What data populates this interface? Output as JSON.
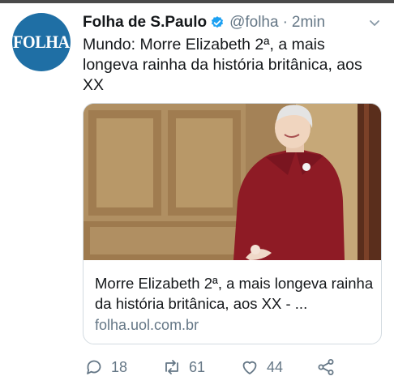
{
  "tweet": {
    "author_name": "Folha de S.Paulo",
    "handle": "@folha",
    "separator": "·",
    "time": "2min",
    "text": "Mundo: Morre Elizabeth 2ª, a mais longeva rainha da história britânica, aos XX",
    "avatar_text": "FOLHA"
  },
  "card": {
    "title": "Morre Elizabeth 2ª, a mais longeva rainha da história britânica, aos XX - ...",
    "domain": "folha.uol.com.br"
  },
  "actions": {
    "replies": "18",
    "retweets": "61",
    "likes": "44"
  },
  "colors": {
    "avatar_bg": "#1f6fa5",
    "verified": "#1da1f2",
    "secondary_text": "#657786",
    "coat": "#8e1b25"
  }
}
